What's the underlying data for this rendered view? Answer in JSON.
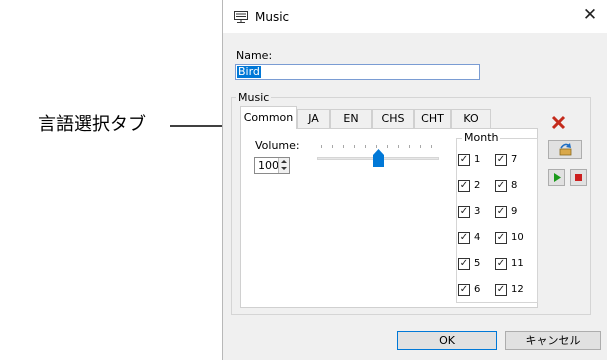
{
  "annotation": {
    "label": "言語選択タブ"
  },
  "dialog": {
    "title": "Music",
    "name": {
      "label": "Name:",
      "value": "Bird"
    },
    "music_group": {
      "label": "Music",
      "tabs": [
        {
          "label": "Common",
          "active": true
        },
        {
          "label": "JA",
          "active": false
        },
        {
          "label": "EN",
          "active": false
        },
        {
          "label": "CHS",
          "active": false
        },
        {
          "label": "CHT",
          "active": false
        },
        {
          "label": "KO",
          "active": false
        }
      ],
      "volume": {
        "label": "Volume:",
        "value": "100",
        "slider_level": 0.5
      },
      "month": {
        "label": "Month",
        "items": [
          {
            "label": "1",
            "checked": true
          },
          {
            "label": "2",
            "checked": true
          },
          {
            "label": "3",
            "checked": true
          },
          {
            "label": "4",
            "checked": true
          },
          {
            "label": "5",
            "checked": true
          },
          {
            "label": "6",
            "checked": true
          },
          {
            "label": "7",
            "checked": true
          },
          {
            "label": "8",
            "checked": true
          },
          {
            "label": "9",
            "checked": true
          },
          {
            "label": "10",
            "checked": true
          },
          {
            "label": "11",
            "checked": true
          },
          {
            "label": "12",
            "checked": true
          }
        ]
      }
    },
    "side_buttons": [
      "delete-icon",
      "import-icon",
      "play-icon",
      "stop-icon"
    ],
    "buttons": {
      "ok": "OK",
      "cancel": "キャンセル"
    },
    "colors": {
      "accent": "#0078d7",
      "delete": "#c42b1c",
      "play": "#1a9a1a",
      "stop": "#cc1f1f"
    }
  }
}
